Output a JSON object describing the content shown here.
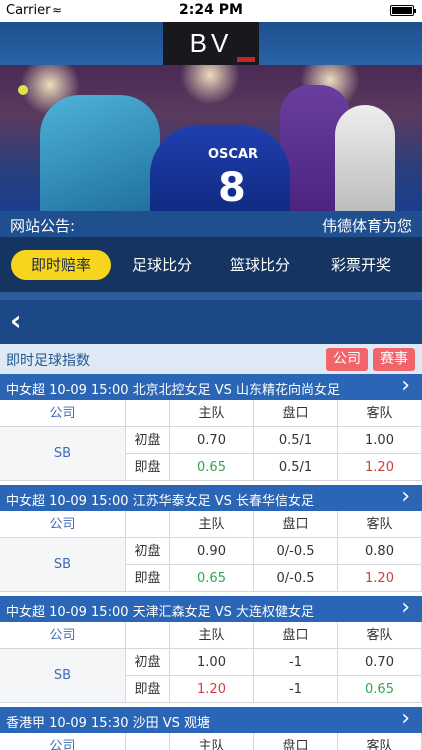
{
  "status_bar": {
    "carrier": "Carrier",
    "time": "2:24 PM"
  },
  "logo": {
    "text": "BV"
  },
  "notice": {
    "label": "网站公告:",
    "text": "伟德体育为您"
  },
  "tabs": [
    {
      "label": "即时赔率",
      "active": true
    },
    {
      "label": "足球比分",
      "active": false
    },
    {
      "label": "篮球比分",
      "active": false
    },
    {
      "label": "彩票开奖",
      "active": false
    }
  ],
  "section": {
    "title": "即时足球指数",
    "company_button": "公司",
    "event_button": "赛事"
  },
  "table_headers": {
    "company": "公司",
    "home": "主队",
    "handicap": "盘口",
    "away": "客队"
  },
  "row_labels": {
    "initial": "初盘",
    "live": "即盘"
  },
  "matches": [
    {
      "title": "中女超 10-09 15:00 北京北控女足 VS 山东精花向尚女足",
      "company": "SB",
      "initial": {
        "home": "0.70",
        "handicap": "0.5/1",
        "away": "1.00"
      },
      "live": {
        "home": "0.65",
        "handicap": "0.5/1",
        "away": "1.20"
      }
    },
    {
      "title": "中女超 10-09 15:00 江苏华泰女足 VS 长春华信女足",
      "company": "SB",
      "initial": {
        "home": "0.90",
        "handicap": "0/-0.5",
        "away": "0.80"
      },
      "live": {
        "home": "0.65",
        "handicap": "0/-0.5",
        "away": "1.20"
      }
    },
    {
      "title": "中女超 10-09 15:00 天津汇森女足 VS 大连权健女足",
      "company": "SB",
      "initial": {
        "home": "1.00",
        "handicap": "-1",
        "away": "0.70"
      },
      "live": {
        "home": "1.20",
        "handicap": "-1",
        "away": "0.65"
      }
    },
    {
      "title": "香港甲 10-09 15:30 沙田 VS 观塘"
    }
  ],
  "colors": {
    "accent_yellow": "#f7d51d",
    "header_blue": "#2b66b6",
    "red": "#d43c3c",
    "green": "#35a64d"
  }
}
